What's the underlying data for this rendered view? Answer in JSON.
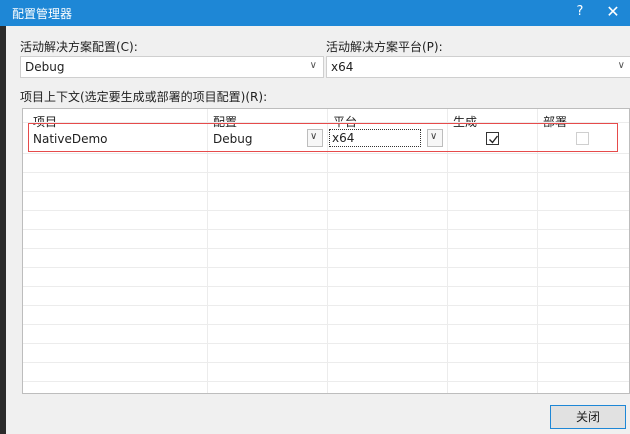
{
  "window": {
    "title": "配置管理器",
    "help_glyph": "?",
    "close_glyph": "✕"
  },
  "active_solution_config": {
    "label": "活动解决方案配置(C):",
    "value": "Debug"
  },
  "active_solution_platform": {
    "label": "活动解决方案平台(P):",
    "value": "x64"
  },
  "project_contexts_label": "项目上下文(选定要生成或部署的项目配置)(R):",
  "grid": {
    "columns": [
      "项目",
      "配置",
      "平台",
      "生成",
      "部署"
    ],
    "rows": [
      {
        "project": "NativeDemo",
        "configuration": "Debug",
        "platform": "x64",
        "build": true,
        "deploy": false
      }
    ]
  },
  "buttons": {
    "close": "关闭"
  },
  "colors": {
    "title_bar": "#1e87d6",
    "highlight_border": "#e64b4b"
  }
}
